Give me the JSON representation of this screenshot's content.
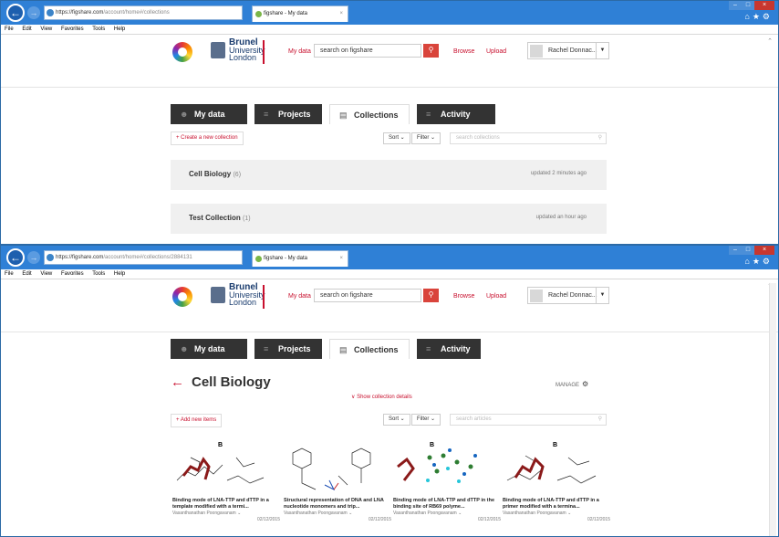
{
  "browser": {
    "tab_title": "figshare - My data",
    "menu": [
      "File",
      "Edit",
      "View",
      "Favorites",
      "Tools",
      "Help"
    ]
  },
  "win1": {
    "url_host": "https://figshare.com",
    "url_path": "/account/home#/collections"
  },
  "win2": {
    "url_host": "https://figshare.com",
    "url_path": "/account/home#/collections/2884131"
  },
  "header": {
    "logo_line1": "Brunel",
    "logo_line2": "University",
    "logo_line3": "London",
    "my_data": "My data",
    "search_value": "search on figshare",
    "browse": "Browse",
    "upload": "Upload",
    "user": "Rachel Donnac..."
  },
  "tabs": [
    {
      "label": "My data",
      "icon": "person-icon"
    },
    {
      "label": "Projects",
      "icon": "list-icon"
    },
    {
      "label": "Collections",
      "icon": "stack-icon"
    },
    {
      "label": "Activity",
      "icon": "list-icon"
    }
  ],
  "collections": {
    "create_label": "+ Create a new collection",
    "sort": "Sort",
    "filter": "Filter",
    "search_placeholder": "search collections",
    "items": [
      {
        "name": "Cell Biology",
        "count": "(6)",
        "updated": "updated 2 minutes ago"
      },
      {
        "name": "Test Collection",
        "count": "(1)",
        "updated": "updated an hour ago"
      }
    ]
  },
  "collection_detail": {
    "title": "Cell Biology",
    "manage": "MANAGE",
    "show_details": "Show collection details",
    "add_items": "+ Add new items",
    "sort": "Sort",
    "filter": "Filter",
    "search_placeholder": "search articles",
    "articles": [
      {
        "title": "Binding mode of LNA-TTP and dTTP in a template modified with a termi...",
        "author": "Vasanthanathan Poongavanam",
        "date": "02/12/2015"
      },
      {
        "title": "Structural representation of DNA and LNA nucleotide monomers and trip...",
        "author": "Vasanthanathan Poongavanam",
        "date": "02/12/2015"
      },
      {
        "title": "Binding mode of LNA-TTP and dTTP in the binding site of RB69 polyme...",
        "author": "Vasanthanathan Poongavanam",
        "date": "02/12/2015"
      },
      {
        "title": "Binding mode of LNA-TTP and dTTP in a primer modified with a termina...",
        "author": "Vasanthanathan Poongavanam",
        "date": "02/12/2015"
      }
    ]
  },
  "colors": {
    "accent": "#c8102e",
    "tab_dark": "#333333",
    "titlebar": "#2f80d6"
  }
}
